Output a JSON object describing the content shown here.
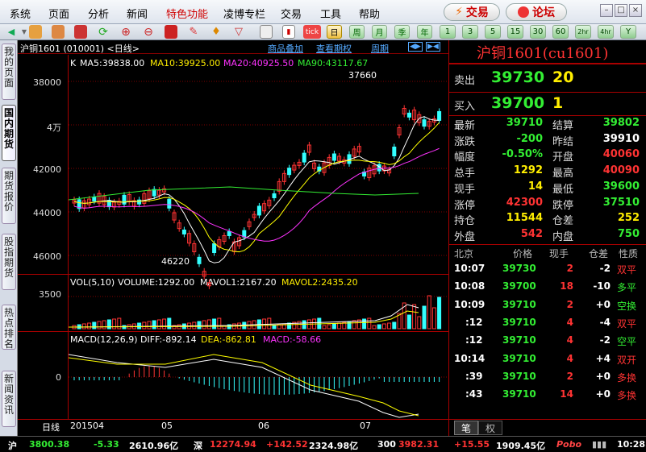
{
  "menu": {
    "items": [
      "系统",
      "页面",
      "分析",
      "新闻",
      "特色功能",
      "凌博专栏",
      "交易",
      "工具",
      "帮助"
    ],
    "trade_btn": "交易",
    "forum_btn": "论坛"
  },
  "toolbar": {
    "periods": [
      "日",
      "周",
      "月",
      "季",
      "年",
      "1",
      "3",
      "5",
      "15",
      "30",
      "60",
      "2hr",
      "4hr",
      "Y"
    ],
    "selected_period": "日"
  },
  "sidebar": {
    "tabs": [
      "我的页面",
      "国内期货",
      "期货报价",
      "股指期货",
      "热点排名",
      "新闻资讯"
    ],
    "active": "国内期货"
  },
  "chart": {
    "header_title": "沪铜1601 (010001)  <日线>",
    "links": {
      "overlay": "商品叠加",
      "view_period": "查看期权",
      "period": "周期"
    },
    "ma_label": "K",
    "ma5": "MA5:39838.00",
    "ma10": "MA10:39925.00",
    "ma20": "MA20:40925.50",
    "ma90": "MA90:43117.67",
    "price_axis": [
      "38000",
      "4万",
      "42000",
      "44000",
      "46000"
    ],
    "high_mark": "37660",
    "low_mark": "46220",
    "vol": {
      "label": "VOL(5,10)",
      "volume": "VOLUME:1292.00",
      "mavol1": "MAVOL1:2167.20",
      "mavol2": "MAVOL2:2435.20",
      "axis": "3500"
    },
    "macd": {
      "label": "MACD(12,26,9)",
      "diff": "DIFF:-892.14",
      "dea": "DEA:-862.81",
      "macd": "MACD:-58.66",
      "axis": "0"
    },
    "xaxis": {
      "period": "日线",
      "labels": [
        "201504",
        "05",
        "06",
        "07"
      ]
    }
  },
  "quote": {
    "title": "沪铜1601(cu1601)",
    "sell": {
      "label": "卖出",
      "price": "39730",
      "vol": "20"
    },
    "buy": {
      "label": "买入",
      "price": "39700",
      "vol": "1"
    },
    "rows": [
      {
        "l1": "最新",
        "v1": "39710",
        "l2": "结算",
        "v2": "39802"
      },
      {
        "l1": "涨跌",
        "v1": "-200",
        "l2": "昨结",
        "v2": "39910"
      },
      {
        "l1": "幅度",
        "v1": "-0.50%",
        "l2": "开盘",
        "v2": "40060"
      },
      {
        "l1": "总手",
        "v1": "1292",
        "l2": "最高",
        "v2": "40090"
      },
      {
        "l1": "现手",
        "v1": "14",
        "l2": "最低",
        "v2": "39600"
      },
      {
        "l1": "涨停",
        "v1": "42300",
        "l2": "跌停",
        "v2": "37510"
      },
      {
        "l1": "持仓",
        "v1": "11544",
        "l2": "仓差",
        "v2": "252"
      },
      {
        "l1": "外盘",
        "v1": "542",
        "l2": "内盘",
        "v2": "750"
      }
    ],
    "ticks_header": {
      "time": "北京",
      "price": "价格",
      "vol": "现手",
      "oi": "仓差",
      "nature": "性质"
    },
    "ticks": [
      {
        "t": "10:07",
        "p": "39730",
        "v": "2",
        "oi": "-2",
        "n": "双平"
      },
      {
        "t": "10:08",
        "p": "39700",
        "v": "18",
        "oi": "-10",
        "n": "多平"
      },
      {
        "t": "10:09",
        "p": "39710",
        "v": "2",
        "oi": "+0",
        "n": "空换"
      },
      {
        "t": ":12",
        "p": "39710",
        "v": "4",
        "oi": "-4",
        "n": "双平"
      },
      {
        "t": ":12",
        "p": "39710",
        "v": "4",
        "oi": "-2",
        "n": "空平"
      },
      {
        "t": "10:14",
        "p": "39710",
        "v": "4",
        "oi": "+4",
        "n": "双开"
      },
      {
        "t": ":39",
        "p": "39710",
        "v": "2",
        "oi": "+0",
        "n": "多换"
      },
      {
        "t": ":43",
        "p": "39710",
        "v": "14",
        "oi": "+0",
        "n": "多换"
      }
    ],
    "bottom_tabs": [
      "笔",
      "权"
    ]
  },
  "status": {
    "sh_label": "沪",
    "sh_idx": "3800.38",
    "sh_chg": "-5.33",
    "sh_amt": "2610.96亿",
    "sz_label": "深",
    "sz_idx": "12274.94",
    "sz_chg": "+142.52",
    "sz_amt": "2324.98亿",
    "hs_label": "300",
    "hs_idx": "3982.31",
    "hs_chg": "+15.55",
    "hs_amt": "1909.45亿",
    "brand": "Pobo",
    "time": "10:28"
  },
  "colors": {
    "up": "#ff3333",
    "down": "#33ffff",
    "ma5": "#ffffff",
    "ma10": "#ffff00",
    "ma20": "#ff33ff",
    "ma90": "#33ee33",
    "grid": "#800000"
  }
}
